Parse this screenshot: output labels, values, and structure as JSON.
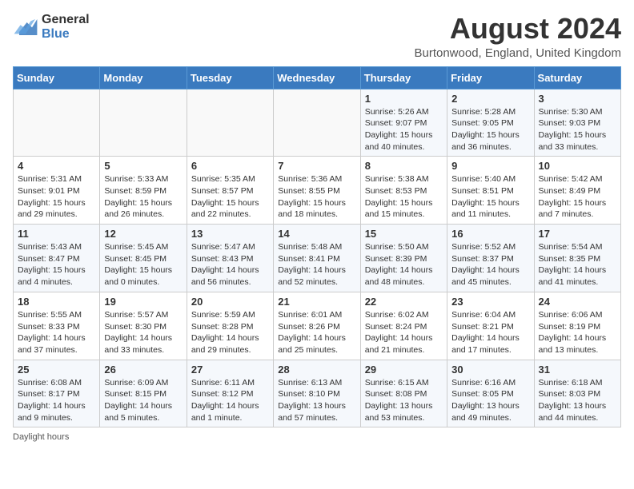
{
  "header": {
    "logo_line1": "General",
    "logo_line2": "Blue",
    "month_year": "August 2024",
    "location": "Burtonwood, England, United Kingdom"
  },
  "days_of_week": [
    "Sunday",
    "Monday",
    "Tuesday",
    "Wednesday",
    "Thursday",
    "Friday",
    "Saturday"
  ],
  "weeks": [
    [
      {
        "day": "",
        "info": ""
      },
      {
        "day": "",
        "info": ""
      },
      {
        "day": "",
        "info": ""
      },
      {
        "day": "",
        "info": ""
      },
      {
        "day": "1",
        "info": "Sunrise: 5:26 AM\nSunset: 9:07 PM\nDaylight: 15 hours\nand 40 minutes."
      },
      {
        "day": "2",
        "info": "Sunrise: 5:28 AM\nSunset: 9:05 PM\nDaylight: 15 hours\nand 36 minutes."
      },
      {
        "day": "3",
        "info": "Sunrise: 5:30 AM\nSunset: 9:03 PM\nDaylight: 15 hours\nand 33 minutes."
      }
    ],
    [
      {
        "day": "4",
        "info": "Sunrise: 5:31 AM\nSunset: 9:01 PM\nDaylight: 15 hours\nand 29 minutes."
      },
      {
        "day": "5",
        "info": "Sunrise: 5:33 AM\nSunset: 8:59 PM\nDaylight: 15 hours\nand 26 minutes."
      },
      {
        "day": "6",
        "info": "Sunrise: 5:35 AM\nSunset: 8:57 PM\nDaylight: 15 hours\nand 22 minutes."
      },
      {
        "day": "7",
        "info": "Sunrise: 5:36 AM\nSunset: 8:55 PM\nDaylight: 15 hours\nand 18 minutes."
      },
      {
        "day": "8",
        "info": "Sunrise: 5:38 AM\nSunset: 8:53 PM\nDaylight: 15 hours\nand 15 minutes."
      },
      {
        "day": "9",
        "info": "Sunrise: 5:40 AM\nSunset: 8:51 PM\nDaylight: 15 hours\nand 11 minutes."
      },
      {
        "day": "10",
        "info": "Sunrise: 5:42 AM\nSunset: 8:49 PM\nDaylight: 15 hours\nand 7 minutes."
      }
    ],
    [
      {
        "day": "11",
        "info": "Sunrise: 5:43 AM\nSunset: 8:47 PM\nDaylight: 15 hours\nand 4 minutes."
      },
      {
        "day": "12",
        "info": "Sunrise: 5:45 AM\nSunset: 8:45 PM\nDaylight: 15 hours\nand 0 minutes."
      },
      {
        "day": "13",
        "info": "Sunrise: 5:47 AM\nSunset: 8:43 PM\nDaylight: 14 hours\nand 56 minutes."
      },
      {
        "day": "14",
        "info": "Sunrise: 5:48 AM\nSunset: 8:41 PM\nDaylight: 14 hours\nand 52 minutes."
      },
      {
        "day": "15",
        "info": "Sunrise: 5:50 AM\nSunset: 8:39 PM\nDaylight: 14 hours\nand 48 minutes."
      },
      {
        "day": "16",
        "info": "Sunrise: 5:52 AM\nSunset: 8:37 PM\nDaylight: 14 hours\nand 45 minutes."
      },
      {
        "day": "17",
        "info": "Sunrise: 5:54 AM\nSunset: 8:35 PM\nDaylight: 14 hours\nand 41 minutes."
      }
    ],
    [
      {
        "day": "18",
        "info": "Sunrise: 5:55 AM\nSunset: 8:33 PM\nDaylight: 14 hours\nand 37 minutes."
      },
      {
        "day": "19",
        "info": "Sunrise: 5:57 AM\nSunset: 8:30 PM\nDaylight: 14 hours\nand 33 minutes."
      },
      {
        "day": "20",
        "info": "Sunrise: 5:59 AM\nSunset: 8:28 PM\nDaylight: 14 hours\nand 29 minutes."
      },
      {
        "day": "21",
        "info": "Sunrise: 6:01 AM\nSunset: 8:26 PM\nDaylight: 14 hours\nand 25 minutes."
      },
      {
        "day": "22",
        "info": "Sunrise: 6:02 AM\nSunset: 8:24 PM\nDaylight: 14 hours\nand 21 minutes."
      },
      {
        "day": "23",
        "info": "Sunrise: 6:04 AM\nSunset: 8:21 PM\nDaylight: 14 hours\nand 17 minutes."
      },
      {
        "day": "24",
        "info": "Sunrise: 6:06 AM\nSunset: 8:19 PM\nDaylight: 14 hours\nand 13 minutes."
      }
    ],
    [
      {
        "day": "25",
        "info": "Sunrise: 6:08 AM\nSunset: 8:17 PM\nDaylight: 14 hours\nand 9 minutes."
      },
      {
        "day": "26",
        "info": "Sunrise: 6:09 AM\nSunset: 8:15 PM\nDaylight: 14 hours\nand 5 minutes."
      },
      {
        "day": "27",
        "info": "Sunrise: 6:11 AM\nSunset: 8:12 PM\nDaylight: 14 hours\nand 1 minute."
      },
      {
        "day": "28",
        "info": "Sunrise: 6:13 AM\nSunset: 8:10 PM\nDaylight: 13 hours\nand 57 minutes."
      },
      {
        "day": "29",
        "info": "Sunrise: 6:15 AM\nSunset: 8:08 PM\nDaylight: 13 hours\nand 53 minutes."
      },
      {
        "day": "30",
        "info": "Sunrise: 6:16 AM\nSunset: 8:05 PM\nDaylight: 13 hours\nand 49 minutes."
      },
      {
        "day": "31",
        "info": "Sunrise: 6:18 AM\nSunset: 8:03 PM\nDaylight: 13 hours\nand 44 minutes."
      }
    ]
  ],
  "footer": {
    "note": "Daylight hours"
  }
}
